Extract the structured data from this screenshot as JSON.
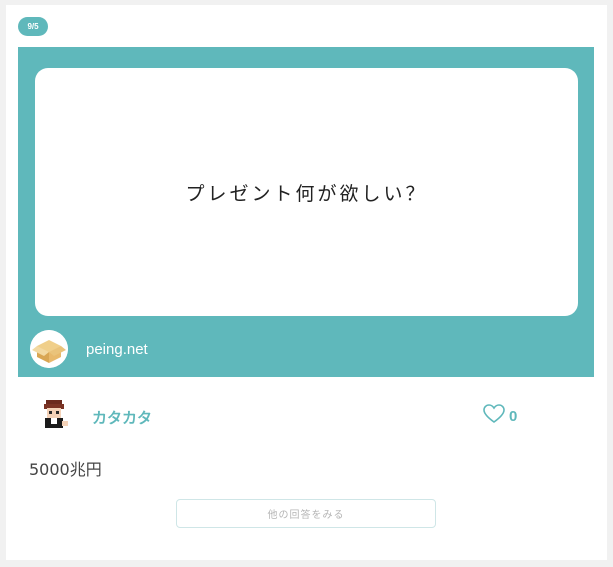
{
  "header": {
    "date_badge": "9/5"
  },
  "question": {
    "text": "プレゼント何が欲しい？",
    "site_name": "peing.net",
    "site_icon": "cardboard-box-icon"
  },
  "answerer": {
    "name": "カタカタ",
    "avatar_icon": "pixel-character-avatar"
  },
  "like": {
    "icon": "heart-icon",
    "count": "0"
  },
  "answer": {
    "text": "5000兆円"
  },
  "footer": {
    "more_answers_label": "他の回答をみる"
  },
  "colors": {
    "accent": "#5fb8bb",
    "text": "#444444",
    "background": "#f1f1f1"
  }
}
